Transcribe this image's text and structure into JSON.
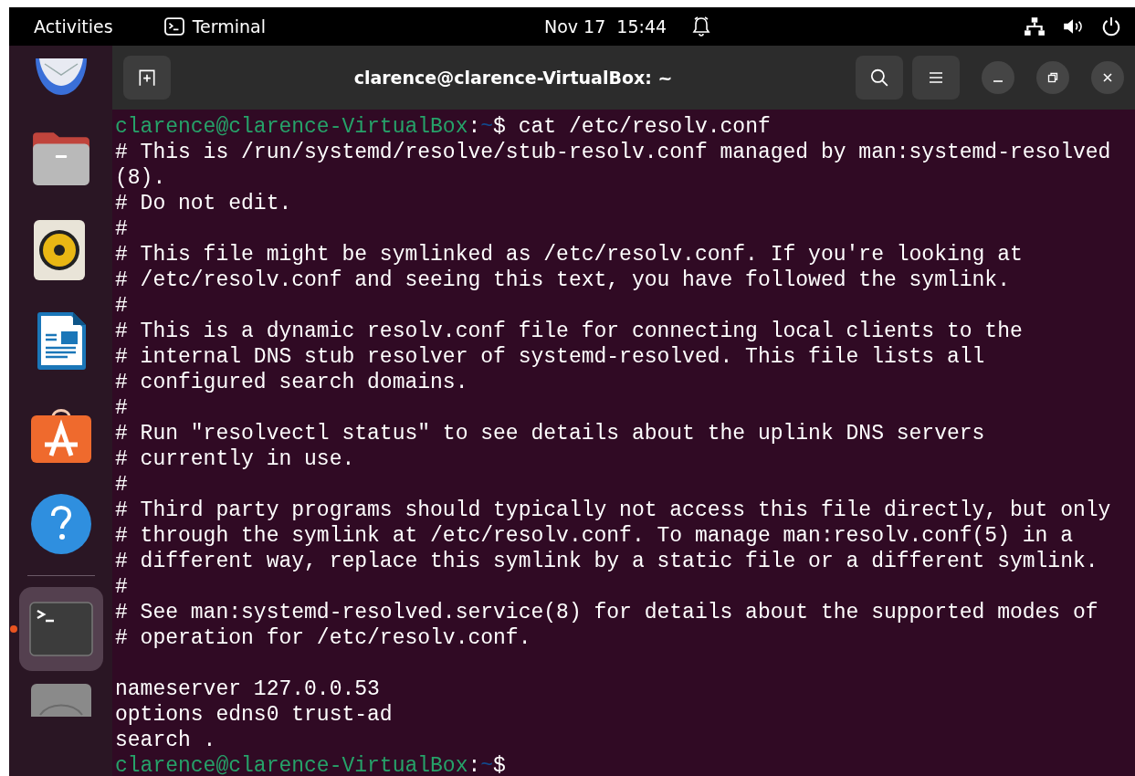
{
  "top_bar": {
    "activities": "Activities",
    "app_name": "Terminal",
    "date": "Nov 17",
    "time": "15:44"
  },
  "dock": {
    "items": [
      {
        "kind": "mail",
        "running": false
      },
      {
        "kind": "folder",
        "running": false
      },
      {
        "kind": "speaker",
        "running": false
      },
      {
        "kind": "document",
        "running": false
      },
      {
        "kind": "store",
        "running": false
      },
      {
        "kind": "help",
        "running": false
      },
      {
        "kind": "separator"
      },
      {
        "kind": "terminal",
        "running": true
      },
      {
        "kind": "disk",
        "running": false
      }
    ]
  },
  "window": {
    "title": "clarence@clarence-VirtualBox: ~"
  },
  "terminal": {
    "lines": [
      {
        "kind": "prompt",
        "user_host": "clarence@clarence-VirtualBox",
        "separator": ":",
        "path": "~",
        "symbol": "$",
        "command": "cat /etc/resolv.conf"
      },
      {
        "kind": "output",
        "text": "# This is /run/systemd/resolve/stub-resolv.conf managed by man:systemd-resolved"
      },
      {
        "kind": "output",
        "text": "(8)."
      },
      {
        "kind": "output",
        "text": "# Do not edit."
      },
      {
        "kind": "output",
        "text": "#"
      },
      {
        "kind": "output",
        "text": "# This file might be symlinked as /etc/resolv.conf. If you're looking at"
      },
      {
        "kind": "output",
        "text": "# /etc/resolv.conf and seeing this text, you have followed the symlink."
      },
      {
        "kind": "output",
        "text": "#"
      },
      {
        "kind": "output",
        "text": "# This is a dynamic resolv.conf file for connecting local clients to the"
      },
      {
        "kind": "output",
        "text": "# internal DNS stub resolver of systemd-resolved. This file lists all"
      },
      {
        "kind": "output",
        "text": "# configured search domains."
      },
      {
        "kind": "output",
        "text": "#"
      },
      {
        "kind": "output",
        "text": "# Run \"resolvectl status\" to see details about the uplink DNS servers"
      },
      {
        "kind": "output",
        "text": "# currently in use."
      },
      {
        "kind": "output",
        "text": "#"
      },
      {
        "kind": "output",
        "text": "# Third party programs should typically not access this file directly, but only"
      },
      {
        "kind": "output",
        "text": "# through the symlink at /etc/resolv.conf. To manage man:resolv.conf(5) in a"
      },
      {
        "kind": "output",
        "text": "# different way, replace this symlink by a static file or a different symlink."
      },
      {
        "kind": "output",
        "text": "#"
      },
      {
        "kind": "output",
        "text": "# See man:systemd-resolved.service(8) for details about the supported modes of"
      },
      {
        "kind": "output",
        "text": "# operation for /etc/resolv.conf."
      },
      {
        "kind": "blank"
      },
      {
        "kind": "output",
        "text": "nameserver 127.0.0.53"
      },
      {
        "kind": "output",
        "text": "options edns0 trust-ad"
      },
      {
        "kind": "output",
        "text": "search ."
      },
      {
        "kind": "prompt",
        "user_host": "clarence@clarence-VirtualBox",
        "separator": ":",
        "path": "~",
        "symbol": "$"
      }
    ]
  }
}
